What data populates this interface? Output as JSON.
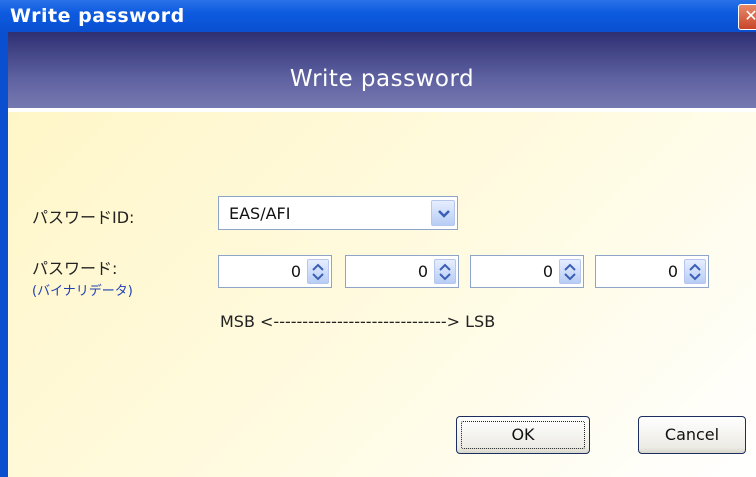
{
  "window": {
    "title": "Write password",
    "close_icon": "close-icon"
  },
  "banner": {
    "title": "Write password"
  },
  "form": {
    "password_id_label": "パスワードID:",
    "password_id_value": "EAS/AFI",
    "password_label": "パスワード:",
    "password_sublabel": "(バイナリデータ)",
    "password_bytes": [
      "0",
      "0",
      "0",
      "0"
    ],
    "byte_order_hint": "MSB <------------------------------> LSB"
  },
  "buttons": {
    "ok": "OK",
    "cancel": "Cancel"
  },
  "colors": {
    "titlebar": "#0a4fd0",
    "banner": "#2d2f72",
    "content_bg": "#fff6c8"
  }
}
